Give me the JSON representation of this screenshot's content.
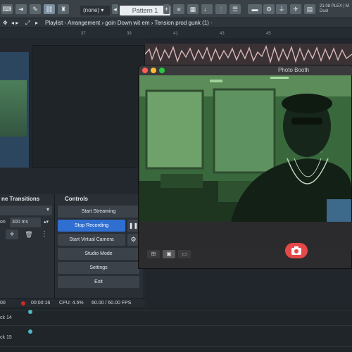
{
  "fl": {
    "pattern": "Pattern 1",
    "name_select": "(none)",
    "playlist_title": "Playlist - Arrangement › goin Down wit em › Tension prod gunk (1) ·",
    "timeline_ticks": [
      "37",
      "39",
      "41",
      "43",
      "45"
    ],
    "meta_line1": "21:08 PLEX | M",
    "meta_line2": "Dust",
    "tracks": [
      "ck 14",
      "ck 15"
    ]
  },
  "obs": {
    "transitions_title": "ne Transitions",
    "duration_value": "300 ms",
    "duration_prefix": "on",
    "controls_title": "Controls",
    "buttons": {
      "start_streaming": "Start Streaming",
      "stop_recording": "Stop Recording",
      "start_virtual_camera": "Start Virtual Camera",
      "studio_mode": "Studio Mode",
      "settings": "Settings",
      "exit": "Exit"
    },
    "status": {
      "left_time": "00",
      "rec_time": "00:00:16",
      "cpu": "CPU: 4.5%",
      "fps": "60.00 / 60.00 FPS"
    }
  },
  "photobooth": {
    "title": "Photo Booth"
  },
  "colors": {
    "accent_blue": "#2f6fd1",
    "shutter_red": "#e54848",
    "green_video": "#2f5a34"
  }
}
